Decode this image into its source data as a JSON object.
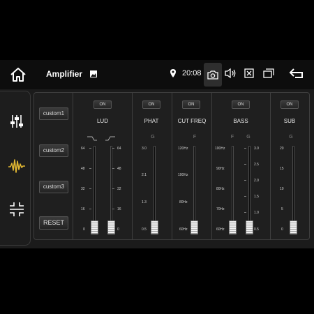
{
  "status_bar": {
    "title": "Amplifier",
    "time": "20:08",
    "icons": [
      "home-icon",
      "image-icon",
      "location-icon",
      "camera-icon",
      "volume-icon",
      "close-box-icon",
      "recent-apps-icon",
      "back-arrow-icon"
    ]
  },
  "sidebar": {
    "items": [
      {
        "name": "equalizer-sliders-icon",
        "active": false
      },
      {
        "name": "waveform-icon",
        "active": true,
        "accent": "#e0b632"
      },
      {
        "name": "balance-arrows-icon",
        "active": false
      }
    ]
  },
  "presets": {
    "custom1": "custom1",
    "custom2": "custom2",
    "custom3": "custom3",
    "reset": "RESET"
  },
  "sections": {
    "lud": {
      "on": "ON",
      "title": "LUD",
      "ticks": [
        "64",
        "48",
        "32",
        "16",
        "0"
      ],
      "ticks_right": [
        "64",
        "48",
        "32",
        "16",
        "0"
      ],
      "sliders": [
        0,
        0
      ]
    },
    "phat": {
      "on": "ON",
      "title": "PHAT",
      "letter": "G",
      "ticks": [
        "3.0",
        "2.1",
        "1.3",
        "0.5"
      ],
      "slider": 0
    },
    "cutfreq": {
      "on": "ON",
      "title": "CUT FREQ",
      "letter": "F",
      "ticks": [
        "120Hz",
        "100Hz",
        "80Hz",
        "60Hz"
      ],
      "slider": 0
    },
    "bass": {
      "on": "ON",
      "title": "BASS",
      "letter_f": "F",
      "letter_g": "G",
      "ticks_f": [
        "100Hz",
        "90Hz",
        "80Hz",
        "70Hz",
        "60Hz"
      ],
      "ticks_g": [
        "3.0",
        "2.5",
        "2.0",
        "1.5",
        "1.0",
        "0.5"
      ],
      "sliders": [
        0,
        0
      ]
    },
    "sub": {
      "on": "ON",
      "title": "SUB",
      "letter": "G",
      "ticks": [
        "20",
        "15",
        "10",
        "5",
        "0"
      ],
      "slider": 0
    }
  },
  "colors": {
    "background": "#1b1b1b",
    "accent": "#e0b632",
    "text": "#e6e6e6"
  }
}
